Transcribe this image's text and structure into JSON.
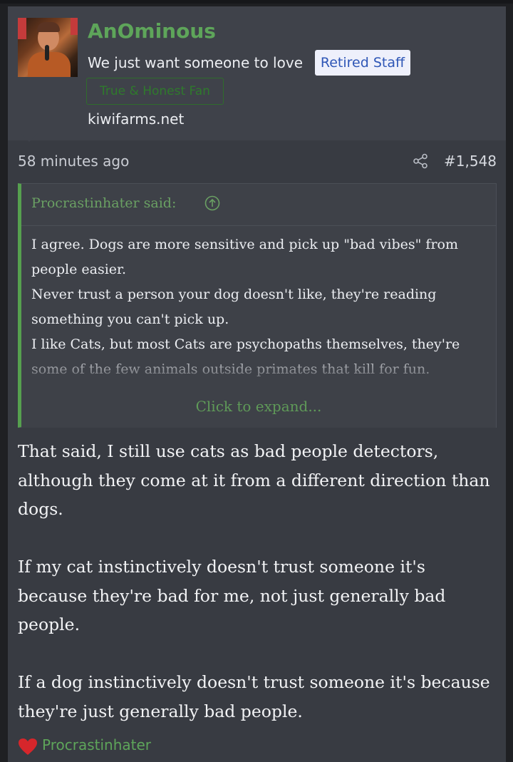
{
  "user": {
    "name": "AnOminous",
    "title": "We just want someone to love",
    "staff_badge": "Retired Staff",
    "fan_badge": "True & Honest Fan",
    "site": "kiwifarms.net"
  },
  "post": {
    "time": "58 minutes ago",
    "number": "#1,548",
    "icons": [
      "share-icon"
    ]
  },
  "quote": {
    "author": "Procrastinhater said:",
    "lines": [
      "I agree. Dogs are more sensitive and pick up \"bad vibes\" from people easier.",
      "Never trust a person your dog doesn't like, they're reading something you can't pick up.",
      "I like Cats, but most Cats are psychopaths themselves, they're some of the few animals outside primates that kill for fun."
    ],
    "expand": "Click to expand..."
  },
  "message": {
    "paragraphs": [
      "That said, I still use cats as bad people detectors, although they come at it from a different direction than dogs.",
      "If my cat instinctively doesn't trust someone it's because they're bad for me, not just generally bad people.",
      "If a dog instinctively doesn't trust someone it's because they're just generally bad people."
    ]
  },
  "reactions": {
    "icon": "heart-icon",
    "user": "Procrastinhater"
  },
  "colors": {
    "username": "#5ea55a",
    "quote_accent": "#56a04f",
    "staff_badge_text": "#2e56b6",
    "background": "#383b42"
  }
}
